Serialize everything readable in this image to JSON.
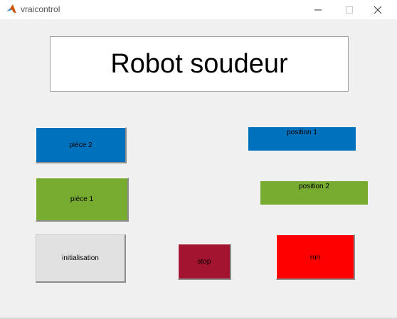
{
  "window": {
    "title": "vraicontrol",
    "minimize_symbol": "—",
    "maximize_symbol": "☐",
    "close_symbol": "✕"
  },
  "panel": {
    "title": "Robot soudeur"
  },
  "buttons": {
    "piece2": {
      "label": "piéce 2",
      "color": "#0072bd"
    },
    "piece1": {
      "label": "piéce 1",
      "color": "#77ac30"
    },
    "initialisation": {
      "label": "initialisation",
      "color": "#e1e1e1"
    },
    "stop": {
      "label": "stop",
      "color": "#a2142f"
    },
    "run": {
      "label": "run",
      "color": "#ff0000"
    },
    "position1": {
      "label": "position 1",
      "color": "#0072bd"
    },
    "position2": {
      "label": "position 2",
      "color": "#77ac30"
    }
  },
  "icons": {
    "app": "matlab-icon",
    "minimize": "minimize-icon",
    "maximize": "maximize-icon",
    "close": "close-icon"
  }
}
